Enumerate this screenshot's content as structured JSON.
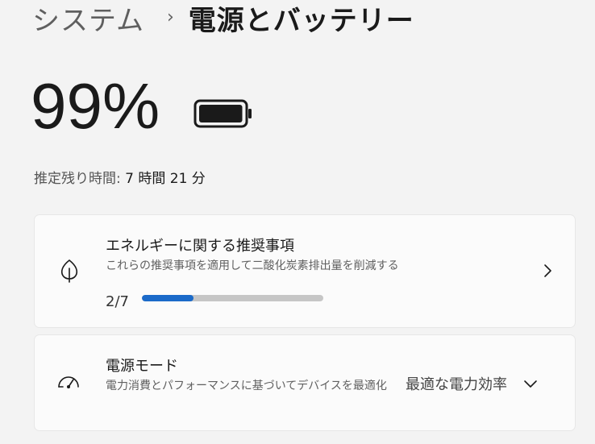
{
  "breadcrumb": {
    "parent": "システム",
    "separator": "›",
    "current": "電源とバッテリー"
  },
  "battery": {
    "percent_text": "99%",
    "level": 0.99,
    "estimate_label": "推定残り時間: ",
    "estimate_value": "7 時間 21 分"
  },
  "recommendations": {
    "title": "エネルギーに関する推奨事項",
    "subtitle": "これらの推奨事項を適用して二酸化炭素排出量を削減する",
    "progress_text": "2/7",
    "progress": 0.2857,
    "icon": "leaf-icon"
  },
  "power_mode": {
    "title": "電源モード",
    "subtitle": "電力消費とパフォーマンスに基づいてデバイスを最適化",
    "value": "最適な電力効率",
    "icon": "gauge-icon"
  },
  "colors": {
    "accent": "#1b6ac9",
    "track": "#c6c6c6",
    "background": "#f3f3f3",
    "card": "#fbfbfb"
  }
}
